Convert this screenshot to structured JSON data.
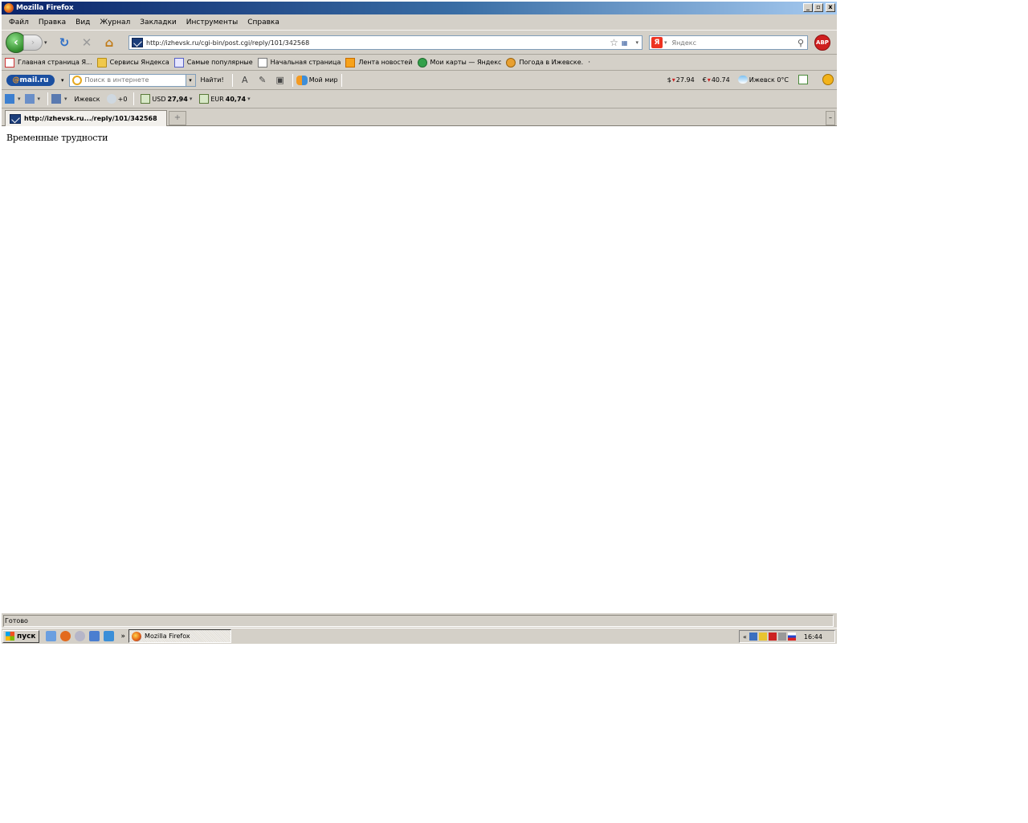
{
  "window": {
    "title": "Mozilla Firefox",
    "controls": {
      "minimize": "_",
      "maximize": "▫",
      "close": "x"
    }
  },
  "menu": [
    "Файл",
    "Правка",
    "Вид",
    "Журнал",
    "Закладки",
    "Инструменты",
    "Справка"
  ],
  "nav": {
    "back": "‹",
    "forward": "›",
    "reload": "↻",
    "stop": "✕",
    "home": "⌂",
    "url": "http://izhevsk.ru/cgi-bin/post.cgi/reply/101/342568",
    "search_placeholder": "Яндекс",
    "search_engine_icon": "Я",
    "adblock_label": "ABP"
  },
  "bookmarks": [
    {
      "label": "Главная страница Я...",
      "icon": "ico-y"
    },
    {
      "label": "Сервисы Яндекса",
      "icon": "ico-folder"
    },
    {
      "label": "Самые популярные",
      "icon": "ico-star"
    },
    {
      "label": "Начальная страница",
      "icon": "ico-page"
    },
    {
      "label": "Лента новостей",
      "icon": "ico-rss"
    },
    {
      "label": "Мои карты — Яндекс",
      "icon": "ico-map"
    },
    {
      "label": "Погода в Ижевске.",
      "icon": "ico-weather"
    }
  ],
  "mailbar": {
    "logo_at": "@",
    "logo_text": "mail.ru",
    "search_placeholder": "Поиск в интернете",
    "find_label": "Найти!",
    "moimir_label": "Мой мир",
    "usd_rate": "27.94",
    "eur_rate": "40.74",
    "weather": "Ижевск 0°C"
  },
  "infobar": {
    "city": "Ижевск",
    "temp": "+0",
    "usd": {
      "label": "USD",
      "value": "27,94"
    },
    "eur": {
      "label": "EUR",
      "value": "40,74"
    }
  },
  "tab": {
    "title": "http://izhevsk.ru.../reply/101/342568",
    "new_tab": "+"
  },
  "page": {
    "text": "Временные трудности"
  },
  "status": {
    "text": "Готово"
  },
  "taskbar": {
    "start_label": "пуск",
    "chevron": "»",
    "task_label": "Mozilla Firefox",
    "tray_chevron": "«",
    "clock": "16:44"
  }
}
